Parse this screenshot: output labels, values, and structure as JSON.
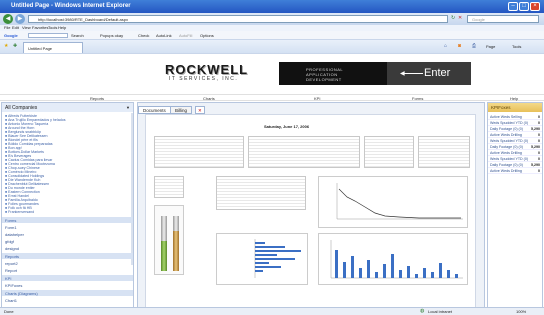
{
  "window": {
    "title": "Untitled Page - Windows Internet Explorer"
  },
  "browser": {
    "url": "http://localhost:3980/RTE_Dashboard/Default.aspx",
    "search_placeholder": "Google",
    "menu": [
      "File",
      "Edit",
      "View",
      "Favorites",
      "Tools",
      "Help"
    ],
    "toolbar": [
      "Google",
      "Search",
      "Popups okay",
      "Check",
      "AutoLink",
      "AutoFill",
      "Options"
    ],
    "tab_label": "Untitled Page",
    "right_tools": [
      "Page",
      "Tools"
    ]
  },
  "banner": {
    "logo": "ROCKWELL",
    "logo_sub": "IT SERVICES, INC.",
    "promo": [
      "PROFESSIONAL",
      "APPLICATION",
      "DEVELOPMENT"
    ],
    "enter_label": "Enter"
  },
  "nav": [
    "Reports",
    "Charts",
    "KPI",
    "Forms",
    "Help"
  ],
  "left_panel": {
    "header": "All Companies",
    "companies": [
      "Alfreds Futterkiste",
      "Ana Trujillo Emparedados y helados",
      "Antonio Moreno Taquería",
      "Around the Horn",
      "Berglunds snabbköp",
      "Blauer See Delikatessen",
      "Blondel père et fils",
      "Bólido Comidas preparadas",
      "Bon app'",
      "Bottom-Dollar Markets",
      "B's Beverages",
      "Cactus Comidas para llevar",
      "Centro comercial Moctezuma",
      "Chop-suey Chinese",
      "Comércio Mineiro",
      "Consolidated Holdings",
      "Die Wandernde Kuh",
      "Drachenblut Delikatessen",
      "Du monde entier",
      "Eastern Connection",
      "Ernst Handel",
      "Familia Arquibaldo",
      "Folies gourmandes",
      "Folk och fä HB",
      "Frankenversand"
    ],
    "sections": [
      {
        "title": "Forms",
        "links": [
          "Form1",
          "datahelper",
          "gfdgf",
          "designd"
        ]
      },
      {
        "title": "Reports",
        "links": [
          "report2",
          "Report"
        ]
      },
      {
        "title": "KPI",
        "links": [
          "KPIFoxes"
        ]
      },
      {
        "title": "Charts (Diagrams)",
        "links": [
          "Chart1"
        ]
      }
    ]
  },
  "center": {
    "tabs": [
      "Documents",
      "Billing"
    ],
    "report_title": "Saturday, June 17, 2006"
  },
  "right_panel": {
    "header": "KPIFoxes",
    "rows": [
      {
        "label": "Active Weds Selling",
        "value": "0"
      },
      {
        "label": "Weds Spudded YTD (0)",
        "value": "0"
      },
      {
        "label": "Daily Footage (0) (0)",
        "value": "5,290"
      },
      {
        "label": "Active Weds Drilling",
        "value": "0"
      },
      {
        "label": "Weds Spudded YTD (0)",
        "value": "0"
      },
      {
        "label": "Daily Footage (0) (0)",
        "value": "5,290"
      },
      {
        "label": "Active Weds Drilling",
        "value": "0"
      },
      {
        "label": "Weds Spudded YTD (0)",
        "value": "0"
      },
      {
        "label": "Daily Footage (0) (0)",
        "value": "5,290"
      },
      {
        "label": "Active Weds Drilling",
        "value": "0"
      }
    ]
  },
  "status": {
    "left": "Done",
    "zone": "Local intranet",
    "zoom": "100%"
  }
}
